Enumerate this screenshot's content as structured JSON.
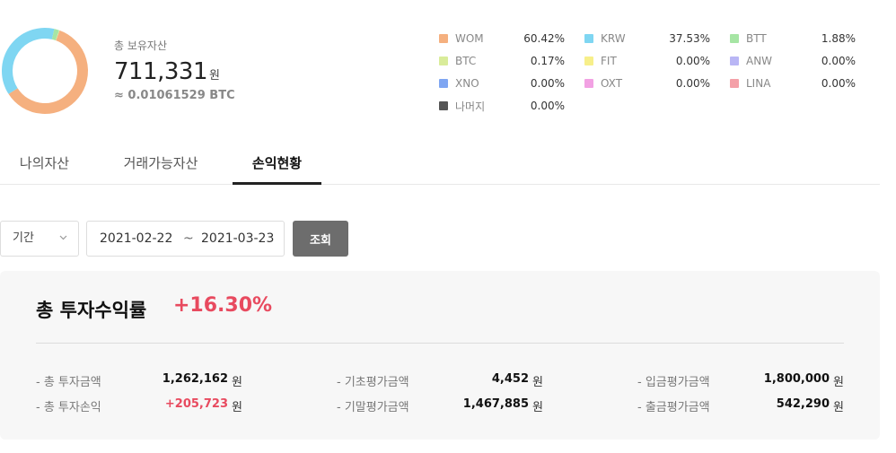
{
  "summary": {
    "label": "총 보유자산",
    "amount": "711,331",
    "unit": "원",
    "btc": "≈ 0.01061529 BTC"
  },
  "chart_data": {
    "type": "pie",
    "categories": [
      "WOM",
      "KRW",
      "BTT",
      "BTC",
      "FIT",
      "ANW",
      "XNO",
      "OXT",
      "LINA",
      "나머지"
    ],
    "values": [
      60.42,
      37.53,
      1.88,
      0.17,
      0.0,
      0.0,
      0.0,
      0.0,
      0.0,
      0.0
    ],
    "colors": [
      "#f5b07f",
      "#7fd6f2",
      "#a6e5a4",
      "#d9ec9a",
      "#f7ef8a",
      "#b9b6f5",
      "#7fa6f2",
      "#f2a1e3",
      "#f4a0a8",
      "#555555"
    ],
    "donut": true
  },
  "legend": [
    {
      "name": "WOM",
      "pct": "60.42%",
      "color": "#f5b07f"
    },
    {
      "name": "KRW",
      "pct": "37.53%",
      "color": "#7fd6f2"
    },
    {
      "name": "BTT",
      "pct": "1.88%",
      "color": "#a6e5a4"
    },
    {
      "name": "BTC",
      "pct": "0.17%",
      "color": "#d9ec9a"
    },
    {
      "name": "FIT",
      "pct": "0.00%",
      "color": "#f7ef8a"
    },
    {
      "name": "ANW",
      "pct": "0.00%",
      "color": "#b9b6f5"
    },
    {
      "name": "XNO",
      "pct": "0.00%",
      "color": "#7fa6f2"
    },
    {
      "name": "OXT",
      "pct": "0.00%",
      "color": "#f2a1e3"
    },
    {
      "name": "LINA",
      "pct": "0.00%",
      "color": "#f4a0a8"
    },
    {
      "name": "나머지",
      "pct": "0.00%",
      "color": "#555555"
    }
  ],
  "tabs": [
    {
      "label": "나의자산"
    },
    {
      "label": "거래가능자산"
    },
    {
      "label": "손익현황",
      "active": true
    }
  ],
  "filter": {
    "period_label": "기간",
    "date_start": "2021-02-22",
    "tilde": "~",
    "date_end": "2021-03-23",
    "search_label": "조회"
  },
  "result": {
    "title": "총 투자수익률",
    "rate": "+16.30%",
    "unit": "원",
    "stats": [
      {
        "label": "- 총 투자금액",
        "value": "1,262,162",
        "positive": false
      },
      {
        "label": "- 총 투자손익",
        "value": "+205,723",
        "positive": true
      },
      {
        "label": "- 기초평가금액",
        "value": "4,452",
        "positive": false
      },
      {
        "label": "- 기말평가금액",
        "value": "1,467,885",
        "positive": false
      },
      {
        "label": "- 입금평가금액",
        "value": "1,800,000",
        "positive": false
      },
      {
        "label": "- 출금평가금액",
        "value": "542,290",
        "positive": false
      }
    ]
  }
}
